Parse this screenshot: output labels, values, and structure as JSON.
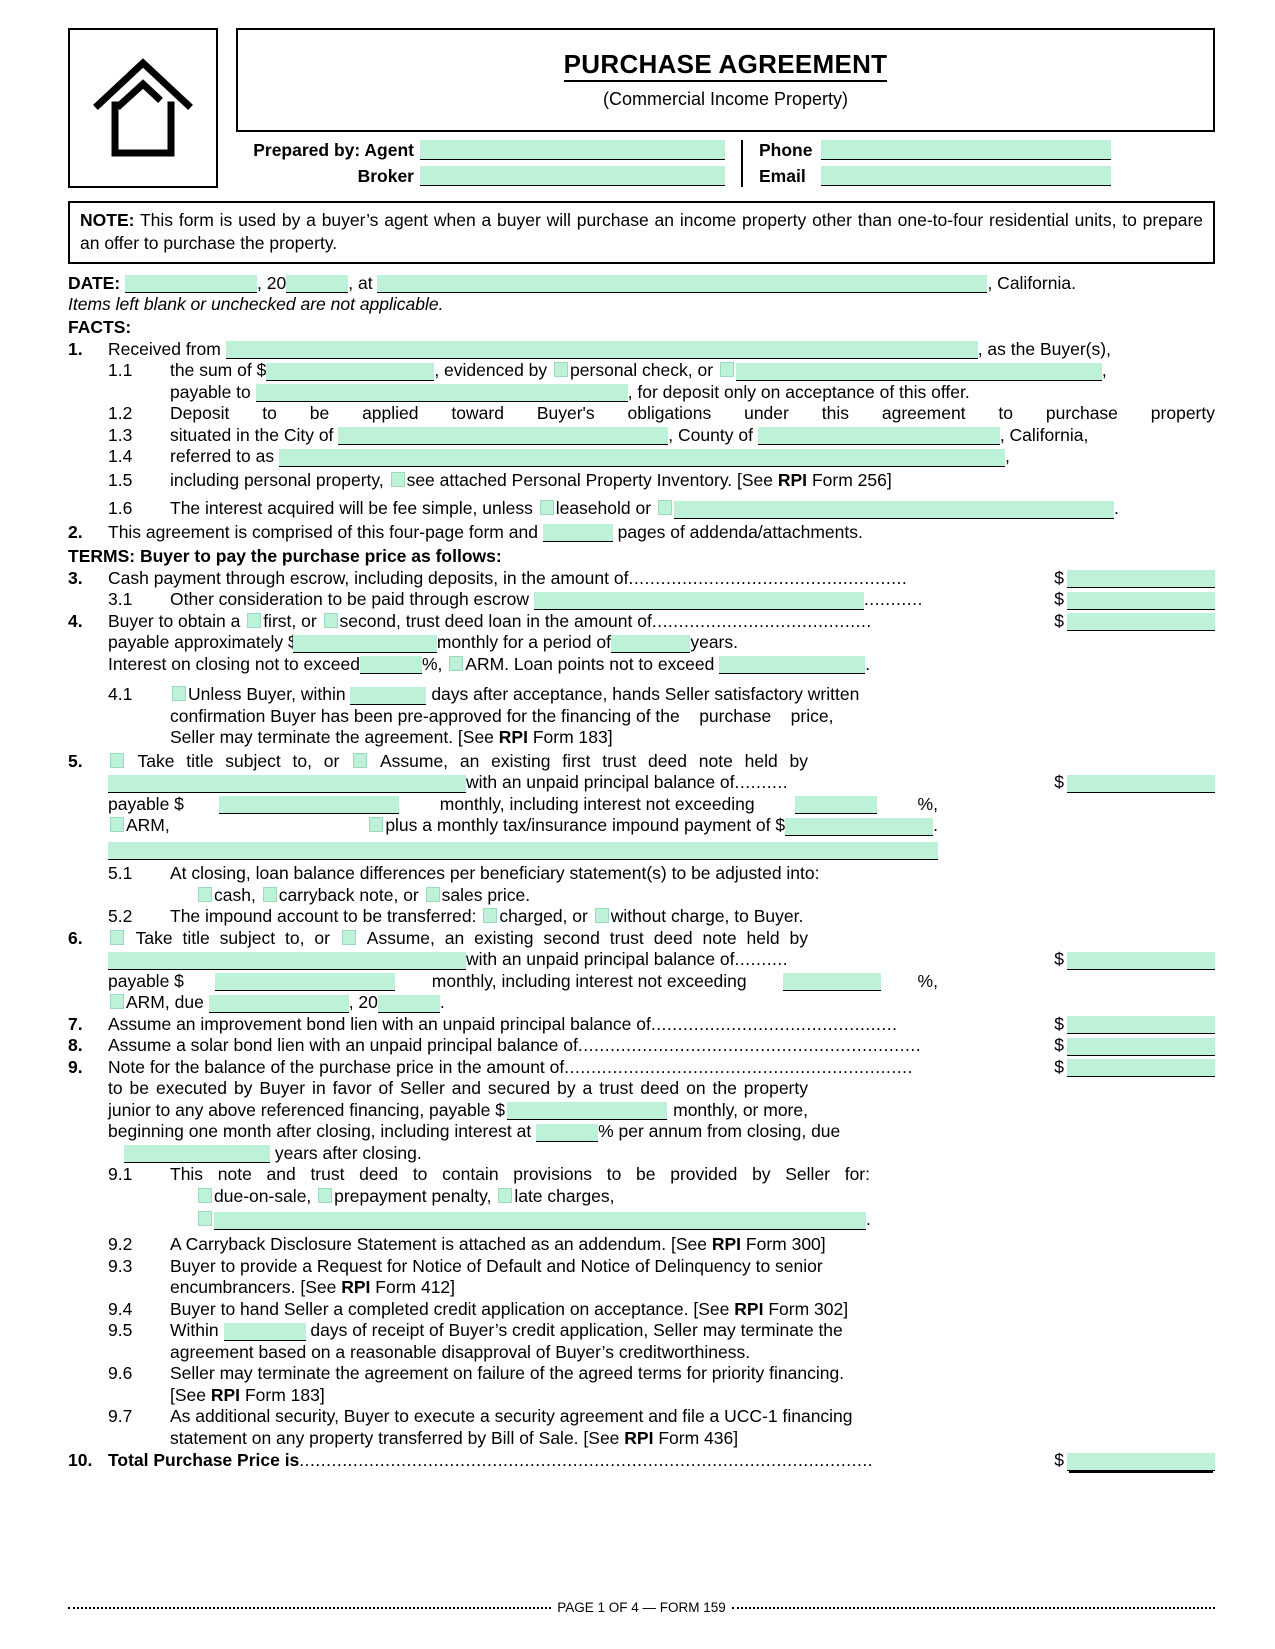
{
  "header": {
    "logo_icon": "house-icon",
    "title": "PURCHASE AGREEMENT",
    "subtitle": "(Commercial Income Property)",
    "prepared_by_label": "Prepared by: Agent",
    "broker_label": "Broker",
    "phone_label": "Phone",
    "email_label": "Email",
    "agent_value": "",
    "broker_value": "",
    "phone_value": "",
    "email_value": ""
  },
  "note": {
    "label": "NOTE:",
    "text": "This form is used by a buyer’s agent when a buyer will purchase an income property other than one-to-four residential units, to prepare an offer to purchase the property."
  },
  "date_line": {
    "label": "DATE:",
    "date_value": "",
    "year_prefix": ", 20",
    "year_value": "",
    "at_label": ", at",
    "place_value": "",
    "state": ", California."
  },
  "blank_note": "Items left blank or unchecked are not applicable.",
  "facts_heading": "FACTS:",
  "terms_heading": "TERMS: Buyer to pay the purchase price as follows:",
  "items": {
    "n1": "1.",
    "i1_a": "Received from",
    "i1_b": ", as the Buyer(s),",
    "n11": "1.1",
    "i11_a": "the sum of $",
    "i11_b": ", evidenced by",
    "i11_c": "personal check, or",
    "i11_d": ",",
    "i11_e": "payable to",
    "i11_f": ", for deposit only on acceptance of this offer.",
    "n12": "1.2",
    "i12": "Deposit to be applied toward Buyer's obligations under this agreement to purchase property",
    "n13": "1.3",
    "i13_a": "situated in the City of",
    "i13_b": ", County of",
    "i13_c": ", California,",
    "n14": "1.4",
    "i14_a": "referred to as",
    "i14_b": ",",
    "n15": "1.5",
    "i15_a": "including personal property,",
    "i15_b": "see attached Personal Property Inventory. [See",
    "i15_rpi": "RPI",
    "i15_c": "Form 256]",
    "n16": "1.6",
    "i16_a": "The interest acquired will be fee simple, unless",
    "i16_b": "leasehold or",
    "i16_c": ".",
    "n2": "2.",
    "i2_a": "This agreement is comprised of this four-page form and",
    "i2_b": "pages of addenda/attachments.",
    "n3": "3.",
    "i3": "Cash payment through escrow, including deposits, in the amount of",
    "i3_dots": "....................................................",
    "n31": "3.1",
    "i31": "Other consideration to be paid through escrow",
    "i31_dots": "...........",
    "n4": "4.",
    "i4_a": "Buyer to obtain a",
    "i4_b": "first, or",
    "i4_c": "second, trust deed loan in the amount of",
    "i4_dots": ".........................................",
    "i4_d": "payable approximately $",
    "i4_e": "monthly for a period of",
    "i4_f": "years.",
    "i4_g": "Interest on closing not to exceed",
    "i4_h": "%,",
    "i4_i": "ARM. Loan points not to exceed",
    "i4_j": ".",
    "n41": "4.1",
    "i41_a": "Unless Buyer, within",
    "i41_b": "days after acceptance, hands Seller satisfactory written",
    "i41_c": "confirmation Buyer has been pre-approved for the financing of the    purchase    price,",
    "i41_d": "Seller may terminate the agreement. [See",
    "i41_rpi": "RPI",
    "i41_e": "Form 183]",
    "n5": "5.",
    "i5_a": "Take title subject to, or",
    "i5_b": "Assume, an existing first trust deed note held by",
    "i5_c": "with an unpaid principal balance of",
    "i5_dots": "..........",
    "i5_d": "payable $",
    "i5_e": "monthly, including interest not exceeding",
    "i5_f": "%,",
    "i5_g": "ARM,",
    "i5_h": "plus a monthly tax/insurance impound payment of $",
    "i5_i": ".",
    "n51": "5.1",
    "i51_a": "At closing, loan balance differences per beneficiary statement(s) to be adjusted into:",
    "i51_b": "cash,",
    "i51_c": "carryback note, or",
    "i51_d": "sales price.",
    "n52": "5.2",
    "i52_a": "The impound account to be transferred:",
    "i52_b": "charged, or",
    "i52_c": "without charge, to Buyer.",
    "n6": "6.",
    "i6_a": "Take title subject to, or",
    "i6_b": "Assume, an existing second trust deed note held by",
    "i6_c": "with an unpaid principal balance of",
    "i6_dots": "..........",
    "i6_d": "payable $",
    "i6_e": "monthly, including interest not exceeding",
    "i6_f": "%,",
    "i6_g": "ARM, due",
    "i6_h": ", 20",
    "i6_i": ".",
    "n7": "7.",
    "i7": "Assume an improvement bond lien with an unpaid principal balance of",
    "i7_dots": "..............................................",
    "n8": "8.",
    "i8": "Assume a solar bond lien with an unpaid principal balance of",
    "i8_dots": "................................................................",
    "n9": "9.",
    "i9": "Note for the balance of the purchase price in the amount of",
    "i9_dots": ".................................................................",
    "i9_a": "to be executed by Buyer in favor of Seller and secured by a trust deed on the property",
    "i9_b": "junior to any above referenced financing, payable $",
    "i9_c": "monthly, or more,",
    "i9_d": "beginning one month after closing, including interest at",
    "i9_e": "% per annum from closing, due",
    "i9_f": "years after closing.",
    "n91": "9.1",
    "i91_a": "This note and trust deed to contain provisions to be provided by Seller for:",
    "i91_b": "due-on-sale,",
    "i91_c": "prepayment penalty,",
    "i91_d": "late charges,",
    "i91_e": ".",
    "n92": "9.2",
    "i92_a": "A Carryback Disclosure Statement is attached as an addendum. [See",
    "i92_rpi": "RPI",
    "i92_b": "Form 300]",
    "n93": "9.3",
    "i93_a": "Buyer to provide a Request for Notice of Default and Notice of Delinquency to senior",
    "i93_b": "encumbrancers. [See",
    "i93_rpi": "RPI",
    "i93_c": "Form 412]",
    "n94": "9.4",
    "i94_a": "Buyer to hand Seller a completed credit application on acceptance. [See",
    "i94_rpi": "RPI",
    "i94_b": "Form 302]",
    "n95": "9.5",
    "i95_a": "Within",
    "i95_b": "days of receipt of Buyer’s credit application, Seller may terminate the",
    "i95_c": "agreement based on a reasonable disapproval of Buyer’s creditworthiness.",
    "n96": "9.6",
    "i96_a": "Seller may terminate the agreement on failure of the agreed terms for priority financing.",
    "i96_b": "[See",
    "i96_rpi": "RPI",
    "i96_c": "Form 183]",
    "n97": "9.7",
    "i97_a": "As additional security, Buyer to execute a security agreement and file a UCC-1 financing",
    "i97_b": "statement on any property transferred by Bill of Sale. [See",
    "i97_rpi": "RPI",
    "i97_c": "Form 436]",
    "n10": "10.",
    "i10": "Total Purchase Price is",
    "i10_dots": "..........................................................................................................."
  },
  "dollar_sign": "$",
  "footer": "PAGE 1 OF 4 — FORM 159",
  "colors": {
    "field_fill": "#bdf2d8",
    "ink": "#000000",
    "paper": "#ffffff"
  }
}
